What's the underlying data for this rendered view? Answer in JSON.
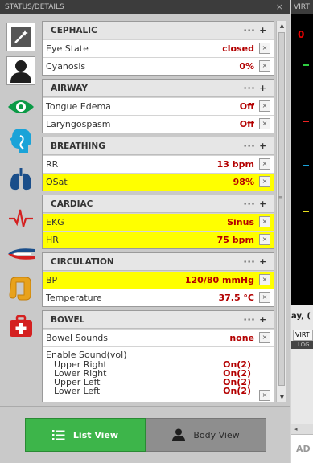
{
  "panel": {
    "title": "STATUS/DETAILS",
    "close": "×"
  },
  "sections": [
    {
      "title": "CEPHALIC",
      "actions": "··· +",
      "rows": [
        {
          "label": "Eye State",
          "value": "closed",
          "highlight": false
        },
        {
          "label": "Cyanosis",
          "value": "0%",
          "highlight": false
        }
      ]
    },
    {
      "title": "AIRWAY",
      "actions": "··· +",
      "rows": [
        {
          "label": "Tongue Edema",
          "value": "Off",
          "highlight": false
        },
        {
          "label": "Laryngospasm",
          "value": "Off",
          "highlight": false
        }
      ]
    },
    {
      "title": "BREATHING",
      "actions": "··· +",
      "rows": [
        {
          "label": "RR",
          "value": "13 bpm",
          "highlight": false
        },
        {
          "label": "OSat",
          "value": "98%",
          "highlight": true
        }
      ]
    },
    {
      "title": "CARDIAC",
      "actions": "··· +",
      "rows": [
        {
          "label": "EKG",
          "value": "Sinus",
          "highlight": true
        },
        {
          "label": "HR",
          "value": "75 bpm",
          "highlight": true
        }
      ]
    },
    {
      "title": "CIRCULATION",
      "actions": "··· +",
      "rows": [
        {
          "label": "BP",
          "value": "120/80 mmHg",
          "highlight": true
        },
        {
          "label": "Temperature",
          "value": "37.5 °C",
          "highlight": false
        }
      ]
    },
    {
      "title": "BOWEL",
      "actions": "··· +",
      "rows": [
        {
          "label": "Bowel Sounds",
          "value": "none",
          "highlight": false
        }
      ],
      "sound": {
        "label": "Enable Sound(vol)",
        "items": [
          {
            "label": "Upper Right",
            "value": "On(2)"
          },
          {
            "label": "Lower Right",
            "value": "On(2)"
          },
          {
            "label": "Upper Left",
            "value": "On(2)"
          },
          {
            "label": "Lower Left",
            "value": "On(2)"
          }
        ]
      }
    }
  ],
  "remove_glyph": "×",
  "bottom": {
    "list_view": "List View",
    "body_view": "Body View"
  },
  "right": {
    "tab_label": "VIRT",
    "counter": "0",
    "day_text": "ay, (",
    "virt_button": "VIRT",
    "log_label": "LOG",
    "add_label": "AD"
  },
  "icons": [
    "magic-wand-icon",
    "person-icon",
    "eye-icon",
    "head-icon",
    "lungs-icon",
    "heartbeat-icon",
    "blood-vessel-icon",
    "intestine-icon",
    "first-aid-icon"
  ],
  "colors": {
    "highlight": "#ffff00",
    "value_text": "#b30000",
    "list_view_button": "#3db54a",
    "body_view_button": "#8e8e8e"
  }
}
